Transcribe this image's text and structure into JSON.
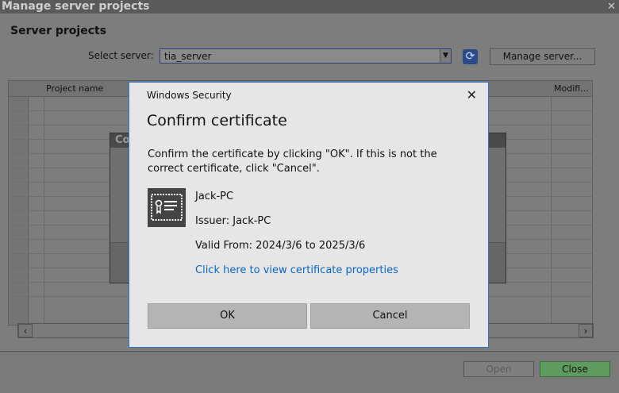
{
  "window": {
    "title": "Manage server projects",
    "close_icon": "close-icon"
  },
  "heading": "Server projects",
  "select_server": {
    "label": "Select server:",
    "value": "tia_server"
  },
  "manage_button": "Manage server...",
  "table": {
    "columns": [
      "Project name",
      "Modifi..."
    ]
  },
  "ghost_dialog": {
    "title_fragment": "Co"
  },
  "footer": {
    "open": "Open",
    "close": "Close"
  },
  "colors": {
    "accent": "#2b73c9",
    "link": "#0a64c8",
    "close_green": "#5f9a5f"
  },
  "dialog": {
    "caption": "Windows Security",
    "title": "Confirm certificate",
    "message": "Confirm the certificate by clicking \"OK\". If this is not the correct certificate, click \"Cancel\".",
    "cert": {
      "name": "Jack-PC",
      "issuer": "Issuer: Jack-PC",
      "valid": "Valid From: 2024/3/6 to 2025/3/6",
      "link": "Click here to view certificate properties"
    },
    "ok": "OK",
    "cancel": "Cancel"
  }
}
